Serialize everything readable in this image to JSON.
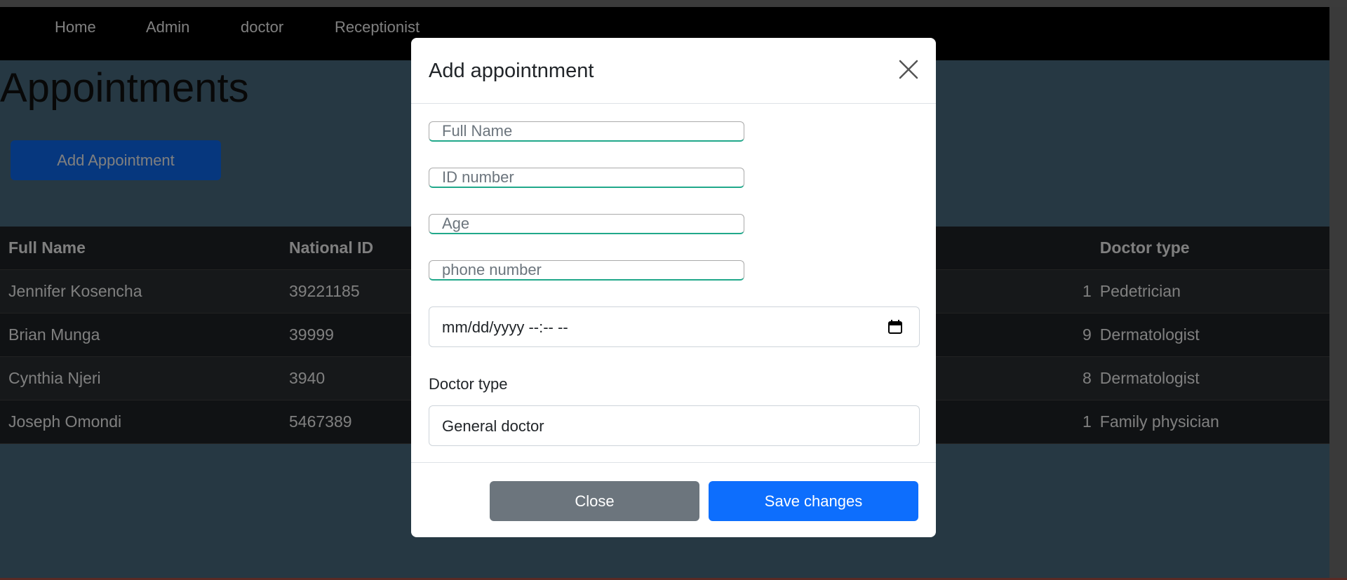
{
  "nav": {
    "items": [
      "Home",
      "Admin",
      "doctor",
      "Receptionist"
    ]
  },
  "page": {
    "title": "Appointments",
    "add_button": "Add Appointment"
  },
  "table": {
    "headers": [
      "Full Name",
      "National ID",
      "",
      "Doctor type"
    ],
    "rows": [
      [
        "Jennifer Kosencha",
        "39221185",
        "1",
        "Pedetrician"
      ],
      [
        "Brian Munga",
        "39999",
        "9",
        "Dermatologist"
      ],
      [
        "Cynthia Njeri",
        "3940",
        "8",
        "Dermatologist"
      ],
      [
        "Joseph Omondi",
        "5467389",
        "1",
        "Family physician"
      ]
    ]
  },
  "modal": {
    "title": "Add appointnment",
    "fields": {
      "full_name_placeholder": "Full Name",
      "id_placeholder": "ID number",
      "age_placeholder": "Age",
      "phone_placeholder": "phone number"
    },
    "date_placeholder": "mm/dd/yyyy --:-- --",
    "doctor_label": "Doctor type",
    "doctor_selected": "General doctor",
    "close_button": "Close",
    "save_button": "Save changes"
  },
  "colors": {
    "primary": "#0d6efd",
    "secondary": "#6c757d",
    "input_accent": "#20a88a",
    "page_bg": "#4d7187",
    "table_bg": "#212529"
  },
  "icons": [
    "close-icon",
    "calendar-icon"
  ]
}
